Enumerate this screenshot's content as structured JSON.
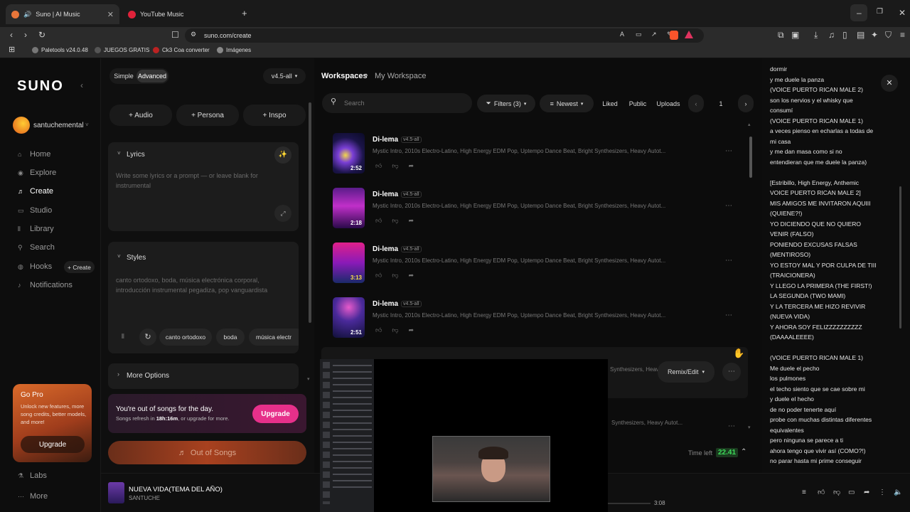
{
  "browser": {
    "tabs": [
      {
        "label": "Suno | AI Music",
        "active": true
      },
      {
        "label": "YouTube Music",
        "active": false
      }
    ],
    "url": "suno.com/create",
    "bookmarks": [
      "Paletools v24.0.48",
      "JUEGOS GRATIS",
      "Ck3 Coa converter",
      "Imágenes"
    ]
  },
  "sidebar": {
    "logo": "SUNO",
    "user": "santuchemental",
    "items": [
      {
        "label": "Home",
        "icon": "home-icon"
      },
      {
        "label": "Explore",
        "icon": "compass-icon"
      },
      {
        "label": "Create",
        "icon": "music-note-icon",
        "selected": true
      },
      {
        "label": "Studio",
        "icon": "studio-icon"
      },
      {
        "label": "Library",
        "icon": "library-icon"
      },
      {
        "label": "Search",
        "icon": "search-icon"
      },
      {
        "label": "Hooks",
        "icon": "hooks-icon",
        "badge": "+ Create"
      },
      {
        "label": "Notifications",
        "icon": "bell-icon"
      }
    ],
    "promo": {
      "title": "Go Pro",
      "text": "Unlock new features, more song credits, better models, and more!",
      "button": "Upgrade"
    },
    "bottom": [
      "Labs",
      "More"
    ]
  },
  "create": {
    "mode_simple": "Simple",
    "mode_advanced": "Advanced",
    "model": "v4.5-all",
    "add_audio": "+ Audio",
    "add_persona": "+ Persona",
    "add_inspo": "+ Inspo",
    "lyrics_label": "Lyrics",
    "lyrics_placeholder": "Write some lyrics or a prompt — or leave blank for instrumental",
    "styles_label": "Styles",
    "styles_value": "canto ortodoxo, boda, música electrónica corporal, introducción instrumental pegadiza, pop vanguardista",
    "style_tags": [
      "canto ortodoxo",
      "boda",
      "música electr"
    ],
    "more_options": "More Options",
    "out_title": "You're out of songs for the day.",
    "out_sub_prefix": "Songs refresh in ",
    "out_sub_time": "18h:16m",
    "out_sub_suffix": ", or upgrade for more.",
    "upgrade": "Upgrade",
    "out_button": "Out of Songs"
  },
  "workspace": {
    "breadcrumb_root": "Workspaces",
    "breadcrumb_current": "My Workspace",
    "search_placeholder": "Search",
    "filters": "Filters (3)",
    "sort": "Newest",
    "liked": "Liked",
    "public": "Public",
    "uploads": "Uploads",
    "page": "1",
    "songs": [
      {
        "title": "Di-lema",
        "version": "v4.5-all",
        "duration": "2:52",
        "desc": "Mystic Intro, 2010s Electro-Latino, High Energy EDM Pop, Uptempo Dance Beat, Bright Synthesizers, Heavy Autot..."
      },
      {
        "title": "Di-lema",
        "version": "v4.5-all",
        "duration": "2:18",
        "desc": "Mystic Intro, 2010s Electro-Latino, High Energy EDM Pop, Uptempo Dance Beat, Bright Synthesizers, Heavy Autot..."
      },
      {
        "title": "Di-lema",
        "version": "v4.5-all",
        "duration": "3:13",
        "desc": "Mystic Intro, 2010s Electro-Latino, High Energy EDM Pop, Uptempo Dance Beat, Bright Synthesizers, Heavy Autot..."
      },
      {
        "title": "Di-lema",
        "version": "v4.5-all",
        "duration": "2:51",
        "desc": "Mystic Intro, 2010s Electro-Latino, High Energy EDM Pop, Uptempo Dance Beat, Bright Synthesizers, Heavy Autot..."
      }
    ],
    "partial_desc": "Synthesizers, Heavy Autot...",
    "remix": "Remix/Edit",
    "time_left_label": "Time left",
    "time_left_value": "22.41"
  },
  "lyrics_panel": {
    "lines": [
      "dormir",
      "y me duele la panza",
      "(VOICE PUERTO RICAN MALE 2)",
      "son los nervios y el whisky que",
      "consumí",
      "(VOICE PUERTO RICAN MALE 1)",
      "a veces pienso en echarlas a todas de",
      "mi casa",
      "y me dan masa como si no",
      "entendieran que me duele la panza)",
      "",
      "[Estribillo, High Energy, Anthemic",
      "VOICE PUERTO RICAN MALE 2]",
      "MIS AMIGOS ME INVITARON AQUIII",
      "(QUIENE?!)",
      "YO DICIENDO QUE NO QUIERO",
      "VENIR (FALSO)",
      "PONIENDO EXCUSAS FALSAS",
      "(MENTIROSO)",
      "YO ESTOY MAL Y POR CULPA DE TIII",
      "(TRAICIONERA)",
      "Y LLEGO LA PRIMERA (THE FIRST!)",
      "LA SEGUNDA (TWO MAMI)",
      "Y LA TERCERA ME HIZO REVIVIR",
      "(NUEVA VIDA)",
      "Y AHORA SOY FELIZZZZZZZZZZ",
      "(DAAAALEEEE)",
      "",
      "(VOICE PUERTO RICAN MALE 1)",
      "Me duele el pecho",
      "los pulmones",
      "el techo siento que se cae sobre mi",
      "y duele el hecho",
      "de no poder tenerte aquí",
      "probe con muchas distintas diferentes",
      "equivalentes",
      "pero ninguna se parece a ti",
      "ahora tengo que vivir así (COMO?!)",
      "no parar hasta mi prime conseguir"
    ]
  },
  "player": {
    "title": "NUEVA VIDA(TEMA DEL AÑO)",
    "artist": "SANTUCHE",
    "time": "3:08"
  },
  "colors": {
    "accent_pink": "#e6308a",
    "promo_orange": "#c9541c",
    "timer_green": "#3ddc5a"
  }
}
